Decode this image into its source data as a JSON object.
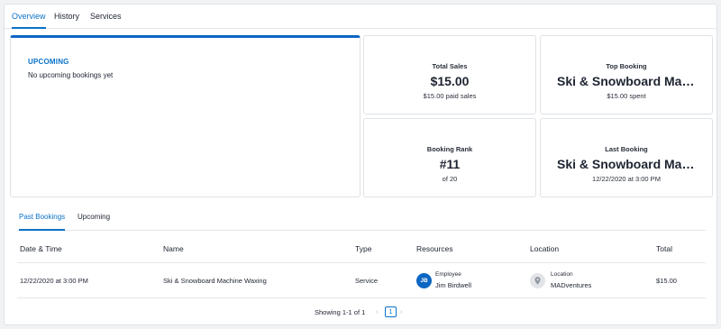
{
  "top_tabs": [
    "Overview",
    "History",
    "Services"
  ],
  "upcoming": {
    "title": "UPCOMING",
    "empty_text": "No upcoming bookings yet"
  },
  "stats": {
    "total_sales": {
      "label": "Total Sales",
      "value": "$15.00",
      "sub": "$15.00 paid sales"
    },
    "top_booking": {
      "label": "Top Booking",
      "value": "Ski & Snowboard Machine Waxing",
      "sub": "$15.00 spent"
    },
    "booking_rank": {
      "label": "Booking Rank",
      "value": "#11",
      "sub": "of 20"
    },
    "last_booking": {
      "label": "Last Booking",
      "value": "Ski & Snowboard Machine Waxing",
      "sub": "12/22/2020 at 3:00 PM"
    }
  },
  "sub_tabs": [
    "Past Bookings",
    "Upcoming"
  ],
  "table": {
    "headers": [
      "Date & Time",
      "Name",
      "Type",
      "Resources",
      "Location",
      "Total"
    ],
    "row": {
      "date_time": "12/22/2020 at 3:00 PM",
      "name": "Ski & Snowboard Machine Waxing",
      "type": "Service",
      "resource_initials": "JB",
      "resource_label": "Employee",
      "resource_name": "Jim Birdwell",
      "location_label": "Location",
      "location_name": "MADventures",
      "total": "$15.00"
    }
  },
  "pagination": {
    "showing": "Showing 1-1 of 1",
    "current_page": "1",
    "prev_icon": "chevron-left",
    "next_icon": "chevron-right"
  },
  "colors": {
    "accent": "#0b72c9",
    "avatar": "#0b66c3"
  }
}
